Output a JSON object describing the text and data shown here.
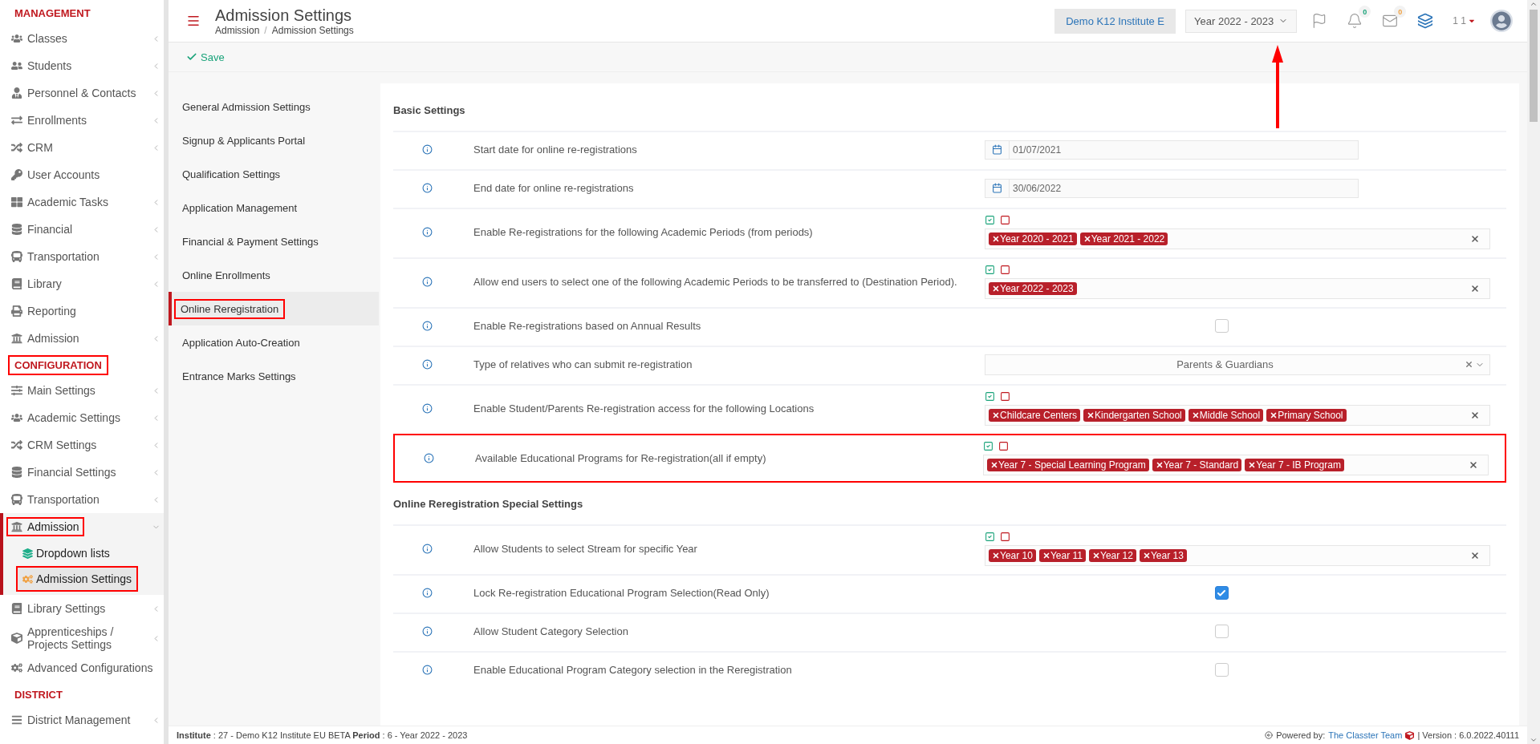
{
  "sidebar": {
    "sections": [
      {
        "title": "MANAGEMENT",
        "highlighted": false,
        "items": [
          {
            "label": "Classes",
            "has_submenu": true
          },
          {
            "label": "Students",
            "has_submenu": true
          },
          {
            "label": "Personnel & Contacts",
            "has_submenu": true
          },
          {
            "label": "Enrollments",
            "has_submenu": true
          },
          {
            "label": "CRM",
            "has_submenu": true
          },
          {
            "label": "User Accounts",
            "has_submenu": false
          },
          {
            "label": "Academic Tasks",
            "has_submenu": true
          },
          {
            "label": "Financial",
            "has_submenu": true
          },
          {
            "label": "Transportation",
            "has_submenu": true
          },
          {
            "label": "Library",
            "has_submenu": true
          },
          {
            "label": "Reporting",
            "has_submenu": false
          },
          {
            "label": "Admission",
            "has_submenu": true
          }
        ]
      },
      {
        "title": "CONFIGURATION",
        "highlighted": true,
        "items": [
          {
            "label": "Main Settings",
            "has_submenu": true
          },
          {
            "label": "Academic Settings",
            "has_submenu": true
          },
          {
            "label": "CRM Settings",
            "has_submenu": true
          },
          {
            "label": "Financial Settings",
            "has_submenu": true
          },
          {
            "label": "Transportation",
            "has_submenu": true
          },
          {
            "label": "Admission",
            "has_submenu": true,
            "expanded": true,
            "highlighted": true,
            "children": [
              {
                "label": "Dropdown lists",
                "selected": false,
                "highlighted": false
              },
              {
                "label": "Admission Settings",
                "selected": true,
                "highlighted": true
              }
            ]
          },
          {
            "label": "Library Settings",
            "has_submenu": true
          },
          {
            "label": "Apprenticeships / Projects Settings",
            "has_submenu": true
          },
          {
            "label": "Advanced Configurations",
            "has_submenu": false
          }
        ]
      },
      {
        "title": "DISTRICT",
        "highlighted": false,
        "items": [
          {
            "label": "District Management",
            "has_submenu": true
          }
        ]
      }
    ]
  },
  "header": {
    "title": "Admission Settings",
    "breadcrumbs": [
      "Admission",
      "Admission Settings"
    ],
    "breadcrumb_separator": "/",
    "institute": "Demo K12 Institute E",
    "year": "Year 2022 - 2023",
    "notifications": "0",
    "messages": "0",
    "user": "1 1"
  },
  "toolbar": {
    "save": "Save"
  },
  "settings_nav": [
    {
      "label": "General Admission Settings",
      "selected": false
    },
    {
      "label": "Signup & Applicants Portal",
      "selected": false
    },
    {
      "label": "Qualification Settings",
      "selected": false
    },
    {
      "label": "Application Management",
      "selected": false
    },
    {
      "label": "Financial & Payment Settings",
      "selected": false
    },
    {
      "label": "Online Enrollments",
      "selected": false
    },
    {
      "label": "Online Reregistration",
      "selected": true
    },
    {
      "label": "Application Auto-Creation",
      "selected": false
    },
    {
      "label": "Entrance Marks Settings",
      "selected": false
    }
  ],
  "sections": [
    {
      "title": "Basic Settings",
      "rows": [
        {
          "kind": "date",
          "label": "Start date for online re-registrations",
          "value": "01/07/2021"
        },
        {
          "kind": "date",
          "label": "End date for online re-registrations",
          "value": "30/06/2022"
        },
        {
          "kind": "tags",
          "label": "Enable Re-registrations for the following Academic Periods (from periods)",
          "tags": [
            "Year 2020 - 2021",
            "Year 2021 - 2022"
          ],
          "highlighted": false
        },
        {
          "kind": "tags",
          "label": "Allow end users to select one of the following Academic Periods to be transferred to (Destination Period).",
          "tags": [
            "Year 2022 - 2023"
          ],
          "highlighted": false
        },
        {
          "kind": "checkbox",
          "label": "Enable Re-registrations based on Annual Results",
          "checked": false
        },
        {
          "kind": "select",
          "label": "Type of relatives who can submit re-registration",
          "value": "Parents & Guardians"
        },
        {
          "kind": "tags",
          "label": "Enable Student/Parents Re-registration access for the following Locations",
          "tags": [
            "Childcare Centers",
            "Kindergarten School",
            "Middle School",
            "Primary School"
          ],
          "highlighted": false
        },
        {
          "kind": "tags",
          "label": "Available Educational Programs for Re-registration(all if empty)",
          "tags": [
            "Year 7 - Special Learning Program",
            "Year 7 - Standard",
            "Year 7 - IB Program"
          ],
          "highlighted": true
        }
      ]
    },
    {
      "title": "Online Reregistration Special Settings",
      "rows": [
        {
          "kind": "tags",
          "label": "Allow Students to select Stream for specific Year",
          "tags": [
            "Year 10",
            "Year 11",
            "Year 12",
            "Year 13"
          ],
          "highlighted": false
        },
        {
          "kind": "checkbox",
          "label": "Lock Re-registration Educational Program Selection(Read Only)",
          "checked": true
        },
        {
          "kind": "checkbox",
          "label": "Allow Student Category Selection",
          "checked": false
        },
        {
          "kind": "checkbox",
          "label": "Enable Educational Program Category selection in the Reregistration",
          "checked": false
        }
      ]
    }
  ],
  "footer": {
    "info": "**Institute** : 27 - Demo K12 Institute EU BETA **Period** : 6 - Year 2022 - 2023",
    "powered": "Powered by:",
    "team": "The Classter Team",
    "version": "| Version : 6.0.2022.40111"
  }
}
